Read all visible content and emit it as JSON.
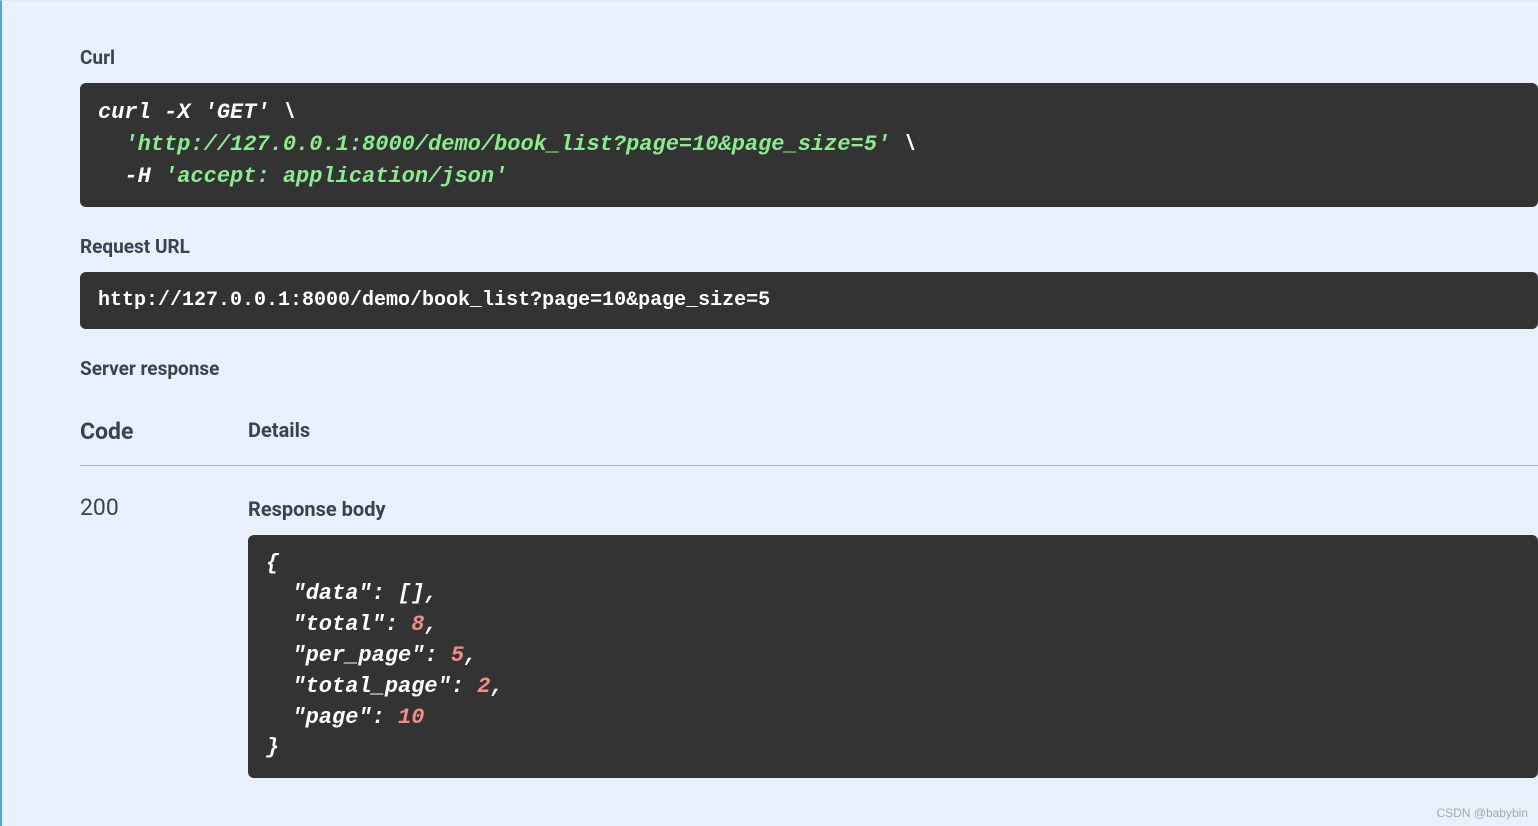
{
  "labels": {
    "curl": "Curl",
    "request_url": "Request URL",
    "server_response": "Server response",
    "code_col": "Code",
    "details_col": "Details",
    "response_body": "Response body"
  },
  "curl": {
    "prefix": "curl -X ",
    "method": "'GET'",
    "backslash": " \\",
    "url": "'http://127.0.0.1:8000/demo/book_list?page=10&page_size=5'",
    "header_flag": "-H ",
    "header_value": "'accept: application/json'"
  },
  "request_url": "http://127.0.0.1:8000/demo/book_list?page=10&page_size=5",
  "response": {
    "status_code": "200",
    "body": {
      "data": [],
      "total": 8,
      "per_page": 5,
      "total_page": 2,
      "page": 10
    }
  },
  "json_text": {
    "open": "{",
    "k_data": "  \"data\"",
    "v_data": "[]",
    "k_total": "  \"total\"",
    "v_total": "8",
    "k_per_page": "  \"per_page\"",
    "v_per_page": "5",
    "k_total_page": "  \"total_page\"",
    "v_total_page": "2",
    "k_page": "  \"page\"",
    "v_page": "10",
    "close": "}",
    "colon": ": ",
    "comma": ","
  },
  "watermark": "CSDN @babybin"
}
